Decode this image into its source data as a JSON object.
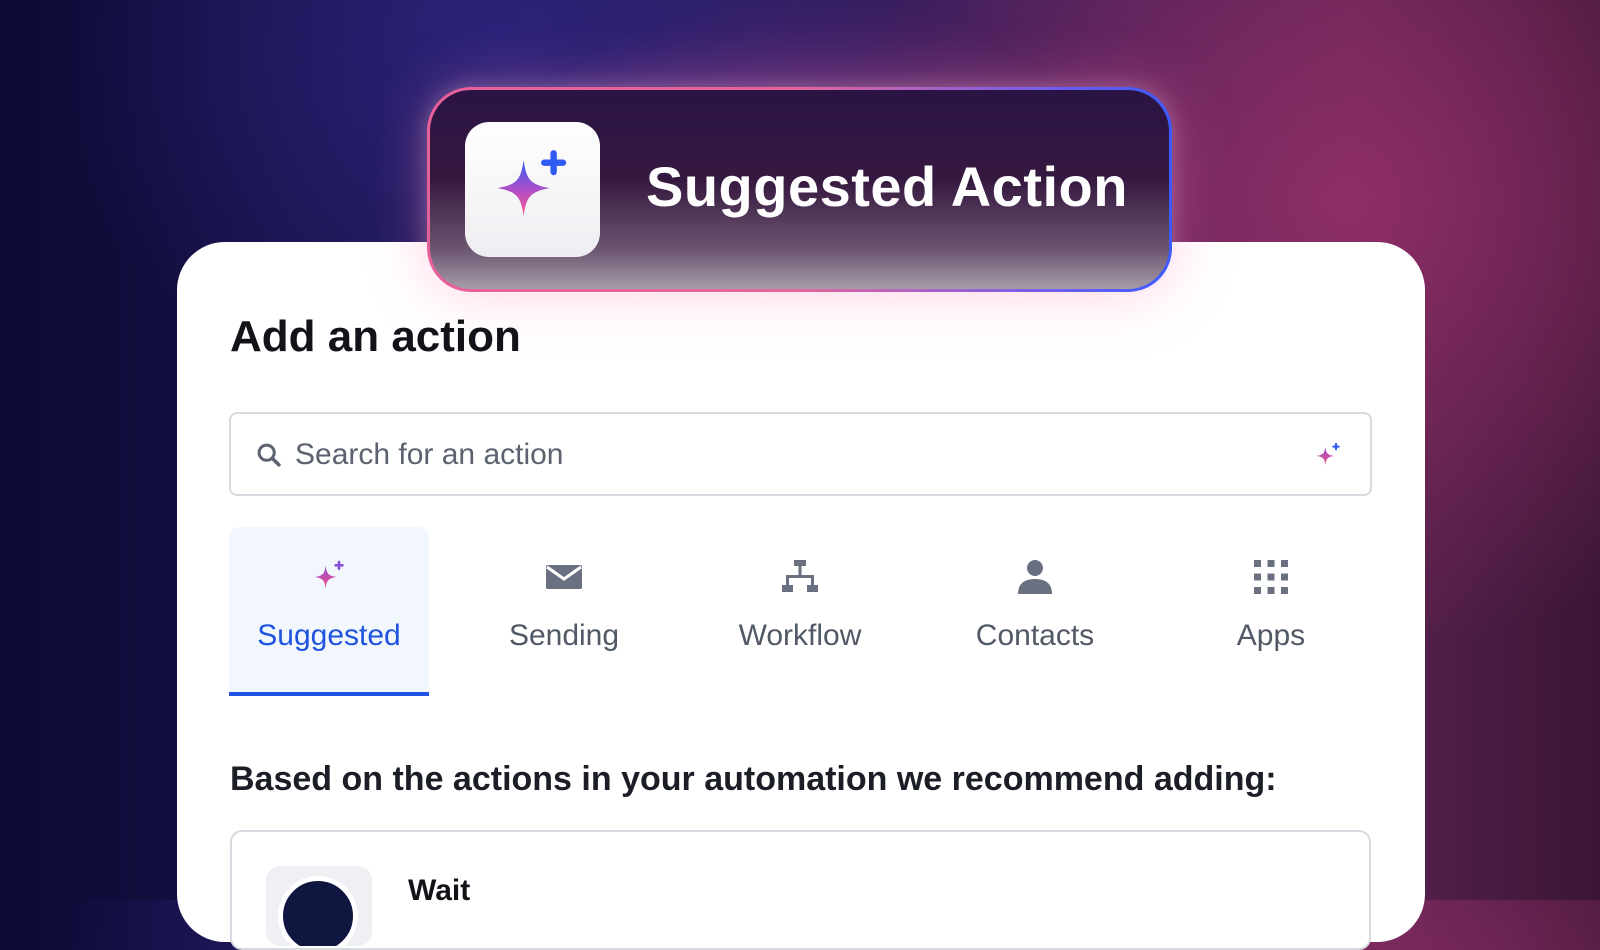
{
  "hero": {
    "title": "Suggested Action",
    "icon": "sparkle-icon"
  },
  "panel": {
    "title": "Add an action",
    "search": {
      "placeholder": "Search for an action",
      "icon": "search-icon",
      "ai_icon": "sparkle-icon"
    },
    "tabs": [
      {
        "label": "Suggested",
        "icon": "sparkle-icon",
        "active": true
      },
      {
        "label": "Sending",
        "icon": "envelope-icon",
        "active": false
      },
      {
        "label": "Workflow",
        "icon": "flowchart-icon",
        "active": false
      },
      {
        "label": "Contacts",
        "icon": "person-icon",
        "active": false
      },
      {
        "label": "Apps",
        "icon": "grid-icon",
        "active": false
      }
    ],
    "recommendation_text": "Based on the actions in your automation we recommend adding:",
    "recommendations": [
      {
        "title": "Wait"
      }
    ]
  },
  "colors": {
    "accent": "#1f54e0",
    "tab_inactive": "#515866",
    "sparkle_top": "#2f5bf2",
    "sparkle_bottom": "#ff5a8a"
  }
}
